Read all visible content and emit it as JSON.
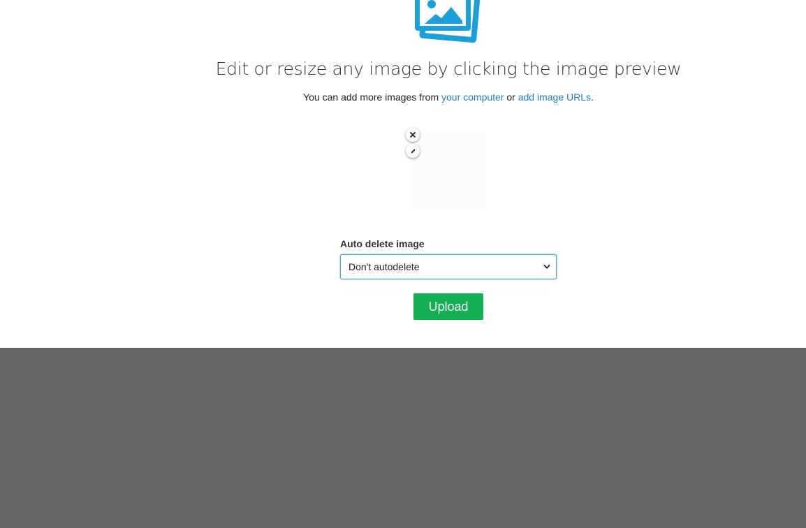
{
  "header": {
    "icon": "images-icon",
    "headline": "Edit or resize any image by clicking the image preview",
    "subline_prefix": "You can add more images from ",
    "link_computer": "your computer",
    "subline_middle": " or ",
    "link_urls": "add image URLs",
    "subline_suffix": "."
  },
  "preview": {
    "remove_icon": "close-icon",
    "edit_icon": "pencil-icon"
  },
  "form": {
    "autodelete_label": "Auto delete image",
    "autodelete_value": "Don't autodelete",
    "upload_label": "Upload"
  },
  "colors": {
    "accent_blue": "#1a9fd9",
    "link": "#1a7fd0",
    "upload_green": "#12b052",
    "footer_bg": "#666666"
  }
}
